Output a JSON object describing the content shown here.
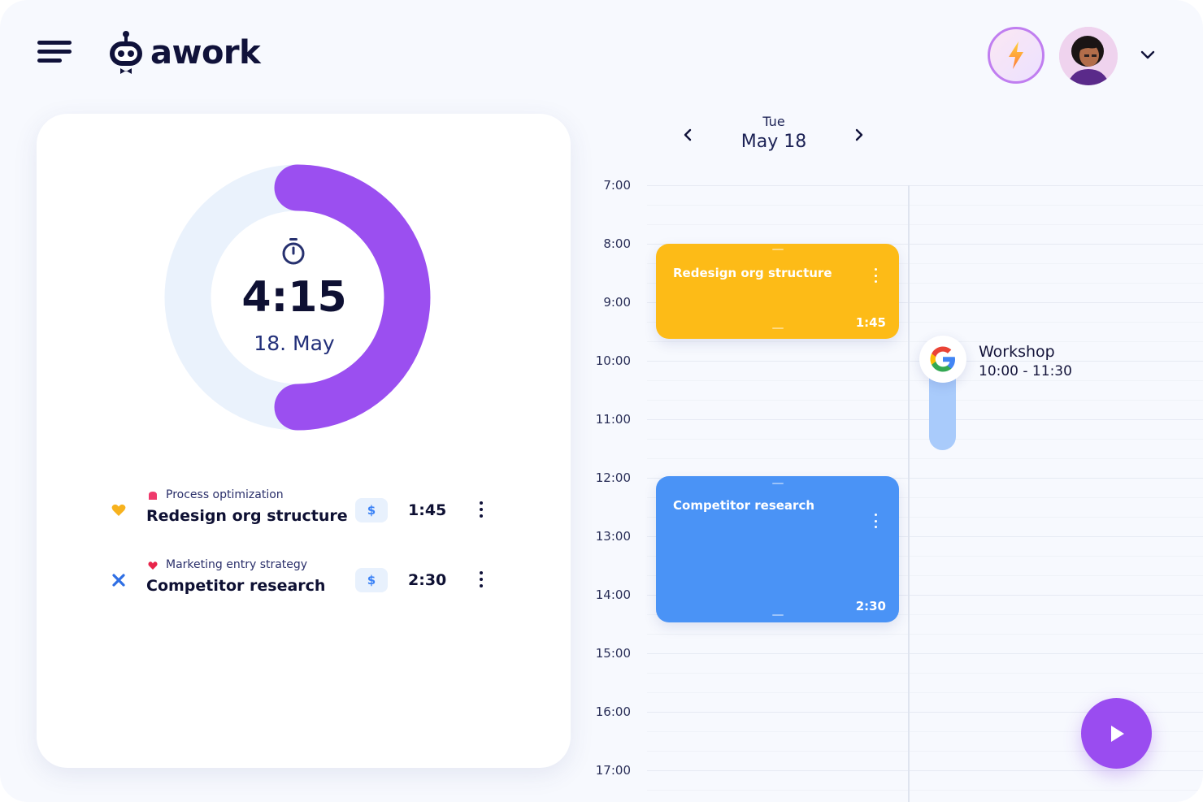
{
  "app": {
    "logo_text": "awork"
  },
  "header": {
    "menu_icon": "hamburger-menu-icon",
    "lightning_icon": "lightning-bolt-icon",
    "chevron_icon": "chevron-down-icon"
  },
  "summary": {
    "total_time": "4:15",
    "date": "18. May",
    "progress_fraction": 0.5,
    "timer_icon": "stopwatch-icon"
  },
  "entries": [
    {
      "project": "Process optimization",
      "task": "Redesign org structure",
      "billable_symbol": "$",
      "duration": "1:45",
      "status_icon": "heart-icon",
      "status_color": "#f7b21e",
      "project_color": "#ef3a6c"
    },
    {
      "project": "Marketing entry strategy",
      "task": "Competitor research",
      "billable_symbol": "$",
      "duration": "2:30",
      "status_icon": "cross-icon",
      "status_color": "#2f6fe4",
      "project_color": "#e8244a"
    }
  ],
  "calendar": {
    "day": "Tue",
    "date": "May 18",
    "hours": [
      "7:00",
      "8:00",
      "9:00",
      "10:00",
      "11:00",
      "12:00",
      "13:00",
      "14:00",
      "15:00",
      "16:00",
      "17:00"
    ],
    "events": [
      {
        "title": "Redesign org structure",
        "duration": "1:45",
        "color": "#fdbb17"
      },
      {
        "title": "Competitor research",
        "duration": "2:30",
        "color": "#4a93f6"
      }
    ],
    "external_event": {
      "source_icon": "google-icon",
      "title": "Workshop",
      "time": "10:00 - 11:30"
    }
  },
  "colors": {
    "accent": "#9a4cf0",
    "text": "#0e1033"
  },
  "play_icon": "play-icon"
}
